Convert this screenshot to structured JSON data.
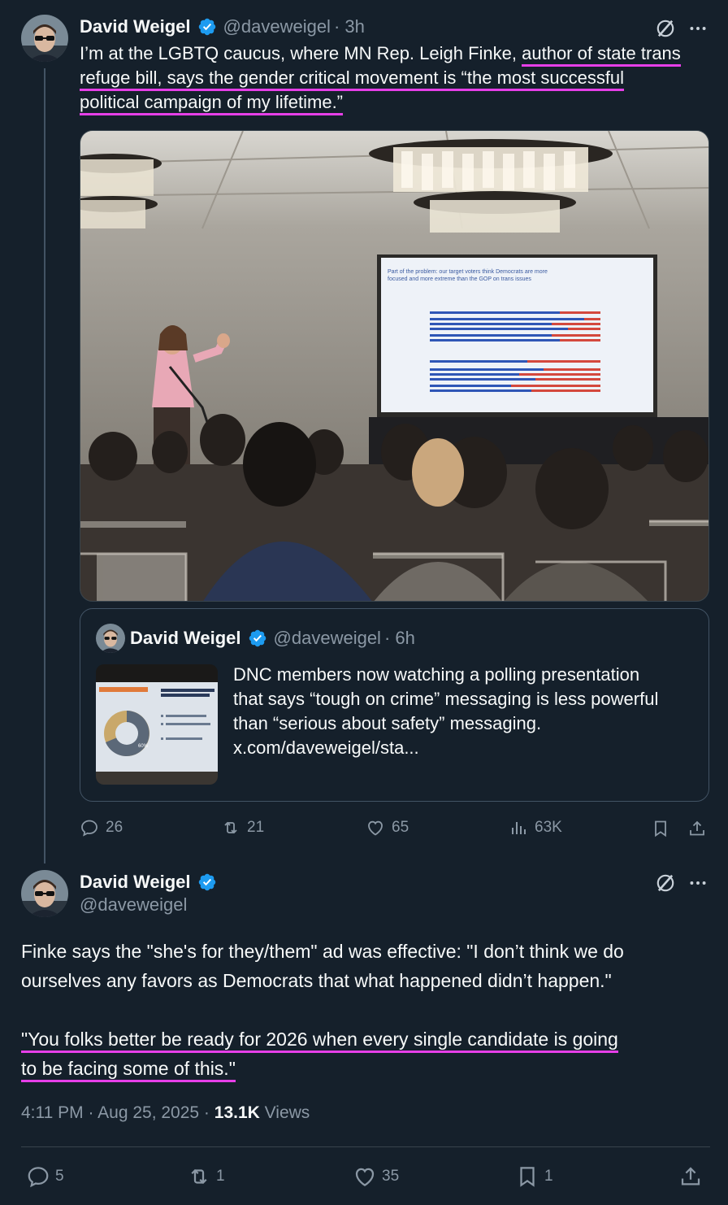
{
  "tweet1": {
    "author_name": "David Weigel",
    "author_handle": "@daveweigel",
    "time": "· 3h",
    "text_plain": "I’m at the LGBTQ caucus, where MN Rep. Leigh Finke, ",
    "text_hl1": "author of state trans",
    "text_hl2": "refuge bill, says the gender critical movement is “the most successful",
    "text_hl3": "political campaign of my lifetime.”",
    "slide_title": "Part of the problem: our target voters think Democrats are more focused and more extreme than the GOP on trans issues",
    "stats": {
      "replies": "26",
      "reposts": "21",
      "likes": "65",
      "views": "63K"
    }
  },
  "quote": {
    "author_name": "David Weigel",
    "author_handle": "@daveweigel",
    "time": "· 6h",
    "text_line1": "DNC members now watching a polling presentation",
    "text_line2": "that says “tough on crime” messaging is less powerful",
    "text_line3": "than “serious about safety” messaging.",
    "text_line4": "x.com/daveweigel/sta...",
    "thumb_percent": "60%"
  },
  "tweet2": {
    "author_name": "David Weigel",
    "author_handle": "@daveweigel",
    "para1_line1": "Finke says the \"she's for they/them\" ad was effective: \"I don’t think we do",
    "para1_line2": "ourselves any favors as Democrats that what happened didn’t happen.\"",
    "para2_line1": "\"You folks better be ready for 2026 when every single candidate is going",
    "para2_line2": "to be facing some of this.\"",
    "timestamp": "4:11 PM · Aug 25, 2025 · ",
    "views_count": "13.1K",
    "views_label": " Views",
    "stats": {
      "replies": "5",
      "reposts": "1",
      "likes": "35",
      "bookmarks": "1"
    }
  },
  "icons": [
    "verified-badge-icon",
    "grok-icon",
    "more-icon",
    "reply-icon",
    "repost-icon",
    "like-icon",
    "views-icon",
    "bookmark-icon",
    "share-icon"
  ],
  "colors": {
    "background": "#15202b",
    "highlight": "#e63fe8",
    "verified": "#1d9bf0",
    "muted": "#8b98a5"
  }
}
